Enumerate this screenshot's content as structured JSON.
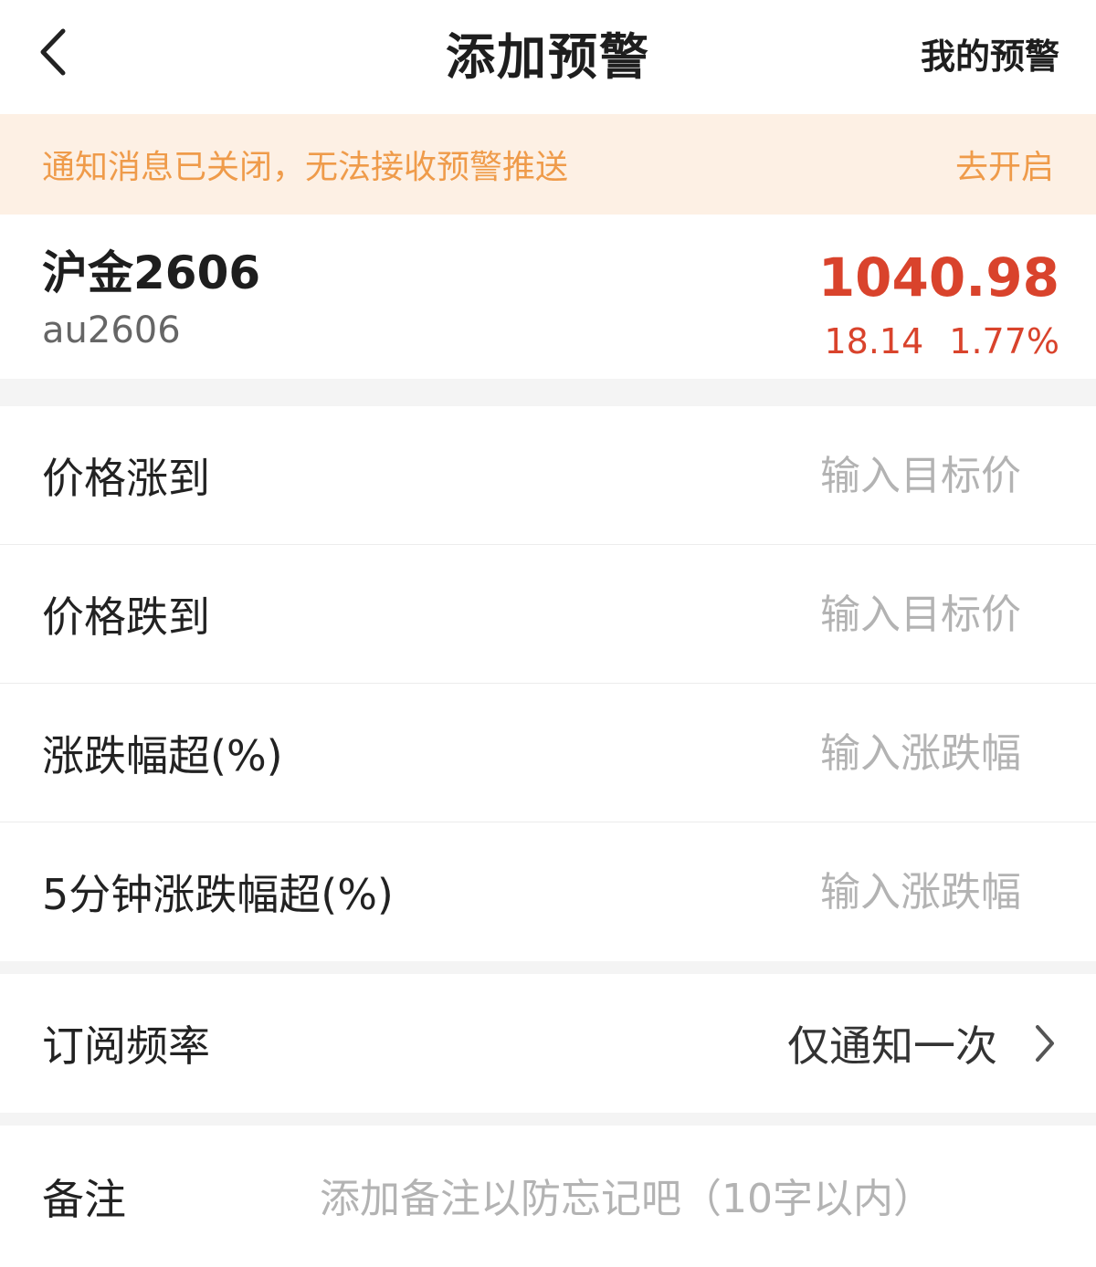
{
  "header": {
    "title": "添加预警",
    "my_alerts_label": "我的预警"
  },
  "notice": {
    "text": "通知消息已关闭，无法接收预警推送",
    "action_label": "去开启"
  },
  "contract": {
    "name": "沪金2606",
    "code": "au2606",
    "price": "1040.98",
    "change": "18.14",
    "change_pct": "1.77%"
  },
  "form": {
    "rows": [
      {
        "label": "价格涨到",
        "placeholder": "输入目标价"
      },
      {
        "label": "价格跌到",
        "placeholder": "输入目标价"
      },
      {
        "label": "涨跌幅超(%)",
        "placeholder": "输入涨跌幅"
      },
      {
        "label": "5分钟涨跌幅超(%)",
        "placeholder": "输入涨跌幅"
      }
    ]
  },
  "frequency": {
    "label": "订阅频率",
    "value": "仅通知一次"
  },
  "remark": {
    "label": "备注",
    "placeholder": "添加备注以防忘记吧（10字以内）"
  },
  "colors": {
    "price_up": "#d9432c",
    "notice_text": "#ef9b4a",
    "notice_bg": "#fdf0e4"
  }
}
